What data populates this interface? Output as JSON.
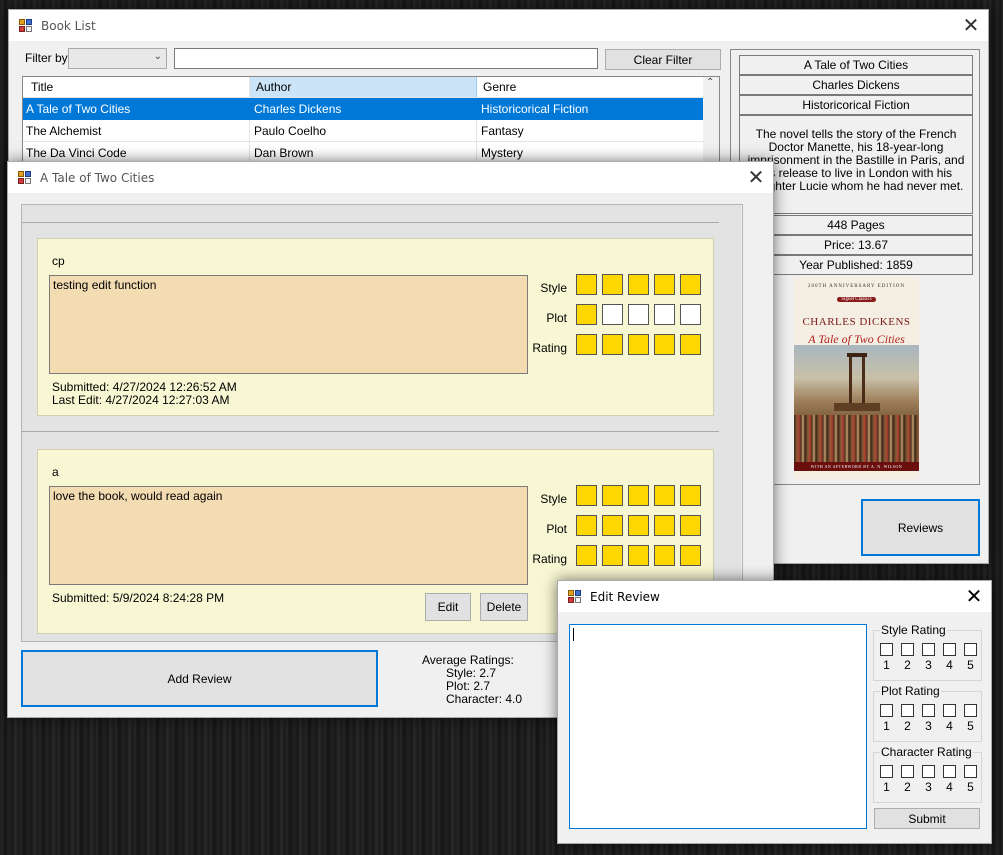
{
  "book_list": {
    "title": "Book List",
    "filter_label": "Filter by",
    "filter_select_value": "",
    "filter_text": "",
    "clear_filter": "Clear Filter",
    "columns": [
      "Title",
      "Author",
      "Genre"
    ],
    "rows": [
      {
        "title": "A Tale of Two Cities",
        "author": "Charles Dickens",
        "genre": "Historicorical Fiction"
      },
      {
        "title": "The Alchemist",
        "author": "Paulo Coelho",
        "genre": "Fantasy"
      },
      {
        "title": "The Da Vinci Code",
        "author": "Dan Brown",
        "genre": "Mystery"
      }
    ],
    "details": {
      "title": "A Tale of Two Cities",
      "author": "Charles Dickens",
      "genre": "Historicorical Fiction",
      "description": "The novel tells the story of the French Doctor Manette, his 18-year-long imprisonment in the Bastille in Paris, and his release to live in London with his daughter Lucie whom he had never met.",
      "pages": "448 Pages",
      "price": "Price: 13.67",
      "year": "Year Published: 1859"
    },
    "cover": {
      "banner": "200th Anniversary Edition",
      "imprint": "Signet Classics",
      "author": "CHARLES DICKENS",
      "title": "A Tale of Two Cities",
      "footer": "With an Afterword by A. N. Wilson"
    },
    "reviews_button": "Reviews"
  },
  "reviews_window": {
    "title": "A Tale of Two Cities",
    "reviews": [
      {
        "user": "cp",
        "text": "testing edit function",
        "submitted": "Submitted: 4/27/2024 12:26:52 AM",
        "last_edit": "Last Edit: 4/27/2024 12:27:03 AM",
        "style": 5,
        "plot": 1,
        "rating": 5
      },
      {
        "user": "a",
        "text": "love the book, would read again",
        "submitted": "Submitted: 5/9/2024 8:24:28 PM",
        "last_edit": "",
        "style": 5,
        "plot": 5,
        "rating": 5
      }
    ],
    "rating_labels": [
      "Style",
      "Plot",
      "Rating"
    ],
    "edit_button": "Edit",
    "delete_button": "Delete",
    "add_review": "Add Review",
    "avg_heading": "Average Ratings:",
    "avg_style": "Style: 2.7",
    "avg_plot": "Plot: 2.7",
    "avg_character": "Character: 4.0"
  },
  "edit_review": {
    "title": "Edit Review",
    "text": "",
    "groups": [
      "Style Rating",
      "Plot Rating",
      "Character Rating"
    ],
    "numbers": [
      "1",
      "2",
      "3",
      "4",
      "5"
    ],
    "submit": "Submit"
  },
  "colors": {
    "selection": "#0078d7",
    "star_filled": "#ffd700",
    "review_card": "#f7f7d3",
    "review_text": "#f3dbb2",
    "column_header_active": "#cce4f7"
  }
}
